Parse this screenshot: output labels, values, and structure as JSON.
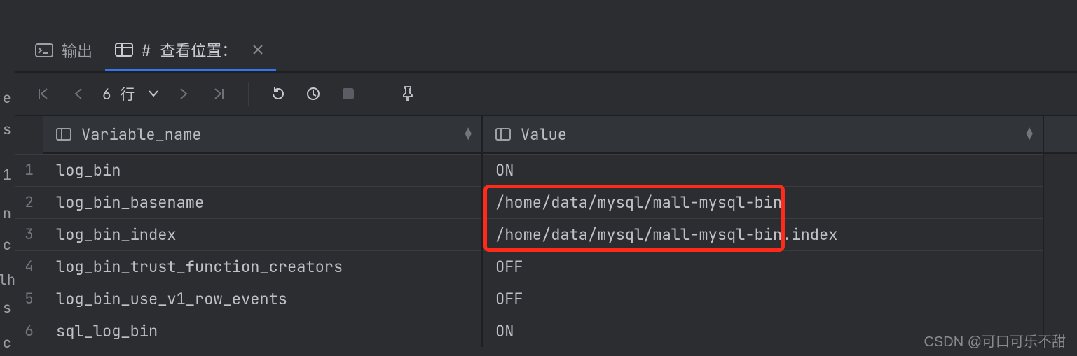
{
  "tabs": {
    "output": {
      "label": "输出"
    },
    "query": {
      "label": "# 查看位置："
    }
  },
  "toolbar": {
    "rows_label": "6 行"
  },
  "table": {
    "columns": {
      "variable": "Variable_name",
      "value": "Value"
    },
    "rows": [
      {
        "variable": "log_bin",
        "value": "ON"
      },
      {
        "variable": "log_bin_basename",
        "value": "/home/data/mysql/mall-mysql-bin"
      },
      {
        "variable": "log_bin_index",
        "value": "/home/data/mysql/mall-mysql-bin.index"
      },
      {
        "variable": "log_bin_trust_function_creators",
        "value": "OFF"
      },
      {
        "variable": "log_bin_use_v1_row_events",
        "value": "OFF"
      },
      {
        "variable": "sql_log_bin",
        "value": "ON"
      }
    ],
    "row_numbers": [
      "1",
      "2",
      "3",
      "4",
      "5",
      "6"
    ]
  },
  "left_gutter_chars": [
    "e",
    "s",
    "1",
    "n",
    "c",
    "lh",
    "s",
    "c"
  ],
  "watermark": "CSDN @可口可乐不甜"
}
